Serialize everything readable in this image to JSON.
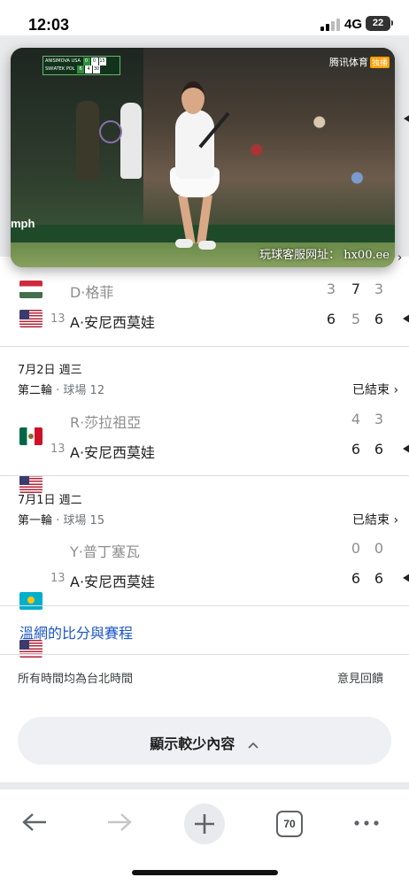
{
  "status_bar": {
    "time": "12:03",
    "network": "4G",
    "battery": "22"
  },
  "video": {
    "scoreboard": [
      {
        "name": "ANISIMOVA USA",
        "sets": [
          "0",
          "0"
        ],
        "points": "15"
      },
      {
        "name": "SWIATEK POL",
        "sets": [
          "6",
          "4"
        ],
        "points": "30"
      }
    ],
    "broadcaster": "腾讯体育",
    "broadcaster_badge": "独播",
    "overlay_text": "玩球客服网址： hx00.ee",
    "sponsor_text": "mph"
  },
  "matches": [
    {
      "players": [
        {
          "flag": "hungary",
          "seed": "",
          "name": "D·格菲",
          "scores": [
            "3",
            "7",
            "3"
          ],
          "winner": false
        },
        {
          "flag": "usa",
          "seed": "13",
          "name": "A·安尼西莫娃",
          "scores": [
            "6",
            "5",
            "6"
          ],
          "winner": true
        }
      ]
    },
    {
      "date": "7月2日 週三",
      "round": "第二輪",
      "court": "· 球場 12",
      "status": "已結束",
      "players": [
        {
          "flag": "mexico",
          "seed": "",
          "name": "R·莎拉祖亞",
          "scores": [
            "4",
            "3"
          ],
          "winner": false
        },
        {
          "flag": "usa",
          "seed": "13",
          "name": "A·安尼西莫娃",
          "scores": [
            "6",
            "6"
          ],
          "winner": true
        }
      ]
    },
    {
      "date": "7月1日 週二",
      "round": "第一輪",
      "court": "· 球場 15",
      "status": "已結束",
      "players": [
        {
          "flag": "kazakhstan",
          "seed": "",
          "name": "Y·普丁塞瓦",
          "scores": [
            "0",
            "0"
          ],
          "winner": false
        },
        {
          "flag": "usa",
          "seed": "13",
          "name": "A·安尼西莫娃",
          "scores": [
            "6",
            "6"
          ],
          "winner": true
        }
      ]
    }
  ],
  "links": {
    "scores_schedule": "溫網的比分與賽程"
  },
  "footer": {
    "timezone_note": "所有時間均為台北時間",
    "feedback": "意見回饋"
  },
  "show_less": {
    "label": "顯示較少內容",
    "icon": "chevron-up-icon"
  },
  "toolbar": {
    "tab_count": "70",
    "back_icon": "arrow-left-icon",
    "forward_icon": "arrow-right-icon",
    "new_tab_icon": "plus-icon",
    "menu_icon": "more-horizontal-icon"
  },
  "colors": {
    "link": "#1a56c9",
    "muted": "#8d8d8d",
    "pill_bg": "#eef0f3"
  }
}
